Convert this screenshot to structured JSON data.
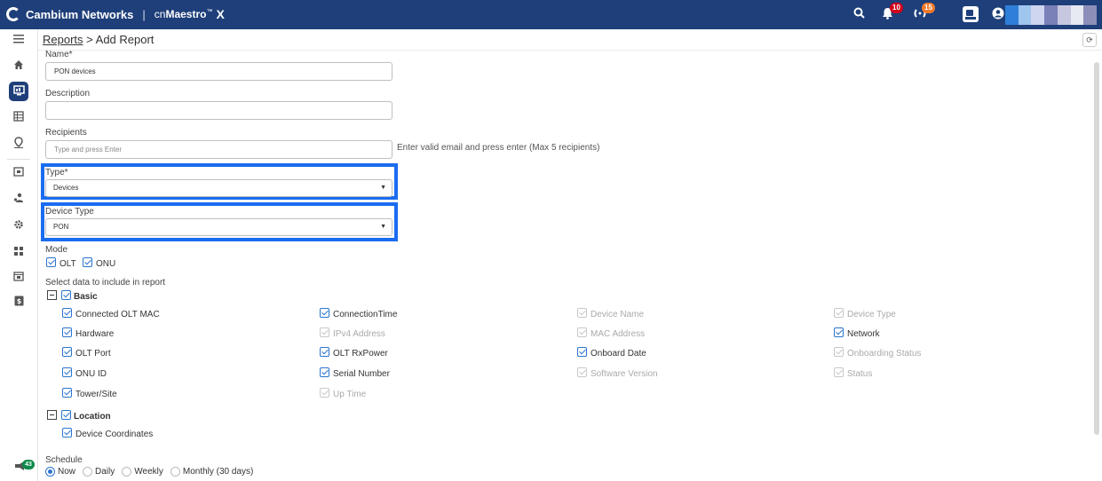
{
  "header": {
    "brand": "Cambium Networks",
    "separator": "|",
    "product_prefix": "cn",
    "product_name": "Maestro",
    "product_tm": "™",
    "product_x": "X",
    "alerts_count": "10",
    "events_count": "15",
    "user_colors": [
      "#2f7fd8",
      "#9fc6ee",
      "#cfd6ef",
      "#7a80b8",
      "#c7c8df",
      "#e7e9f3",
      "#8c8fb9"
    ]
  },
  "sidebar": {
    "items": [
      "menu-icon",
      "home-icon",
      "monitor-icon",
      "table-icon",
      "location-icon",
      "box-icon",
      "users-icon",
      "gear-icon",
      "apps-icon",
      "calendar-icon",
      "dollar-icon"
    ],
    "chat_count": "43",
    "accent": "#1e3f7a"
  },
  "breadcrumb": {
    "root": "Reports",
    "sep": ">",
    "current": "Add Report"
  },
  "form": {
    "name_label": "Name*",
    "name_value": "PON devices",
    "description_label": "Description",
    "description_value": "",
    "recipients_label": "Recipients",
    "recipients_placeholder": "Type and press Enter",
    "recipients_hint": "Enter valid email and press enter (Max 5 recipients)",
    "type_label": "Type*",
    "type_value": "Devices",
    "device_type_label": "Device Type",
    "device_type_value": "PON",
    "mode_label": "Mode",
    "mode_options": [
      "OLT",
      "ONU"
    ],
    "select_data_label": "Select data to include in report",
    "basic_group": "Basic",
    "basic_fields": [
      "Connected OLT MAC",
      "ConnectionTime",
      "Device Name",
      "Device Type",
      "Hardware",
      "IPv4 Address",
      "MAC Address",
      "Network",
      "OLT Port",
      "OLT RxPower",
      "Onboard Date",
      "Onboarding Status",
      "ONU ID",
      "Serial Number",
      "Software Version",
      "Status",
      "Tower/Site",
      "Up Time"
    ],
    "location_group": "Location",
    "location_fields": [
      "Device Coordinates"
    ],
    "schedule_label": "Schedule",
    "schedule_options": [
      "Now",
      "Daily",
      "Weekly",
      "Monthly (30 days)"
    ],
    "schedule_selected": "Now"
  }
}
